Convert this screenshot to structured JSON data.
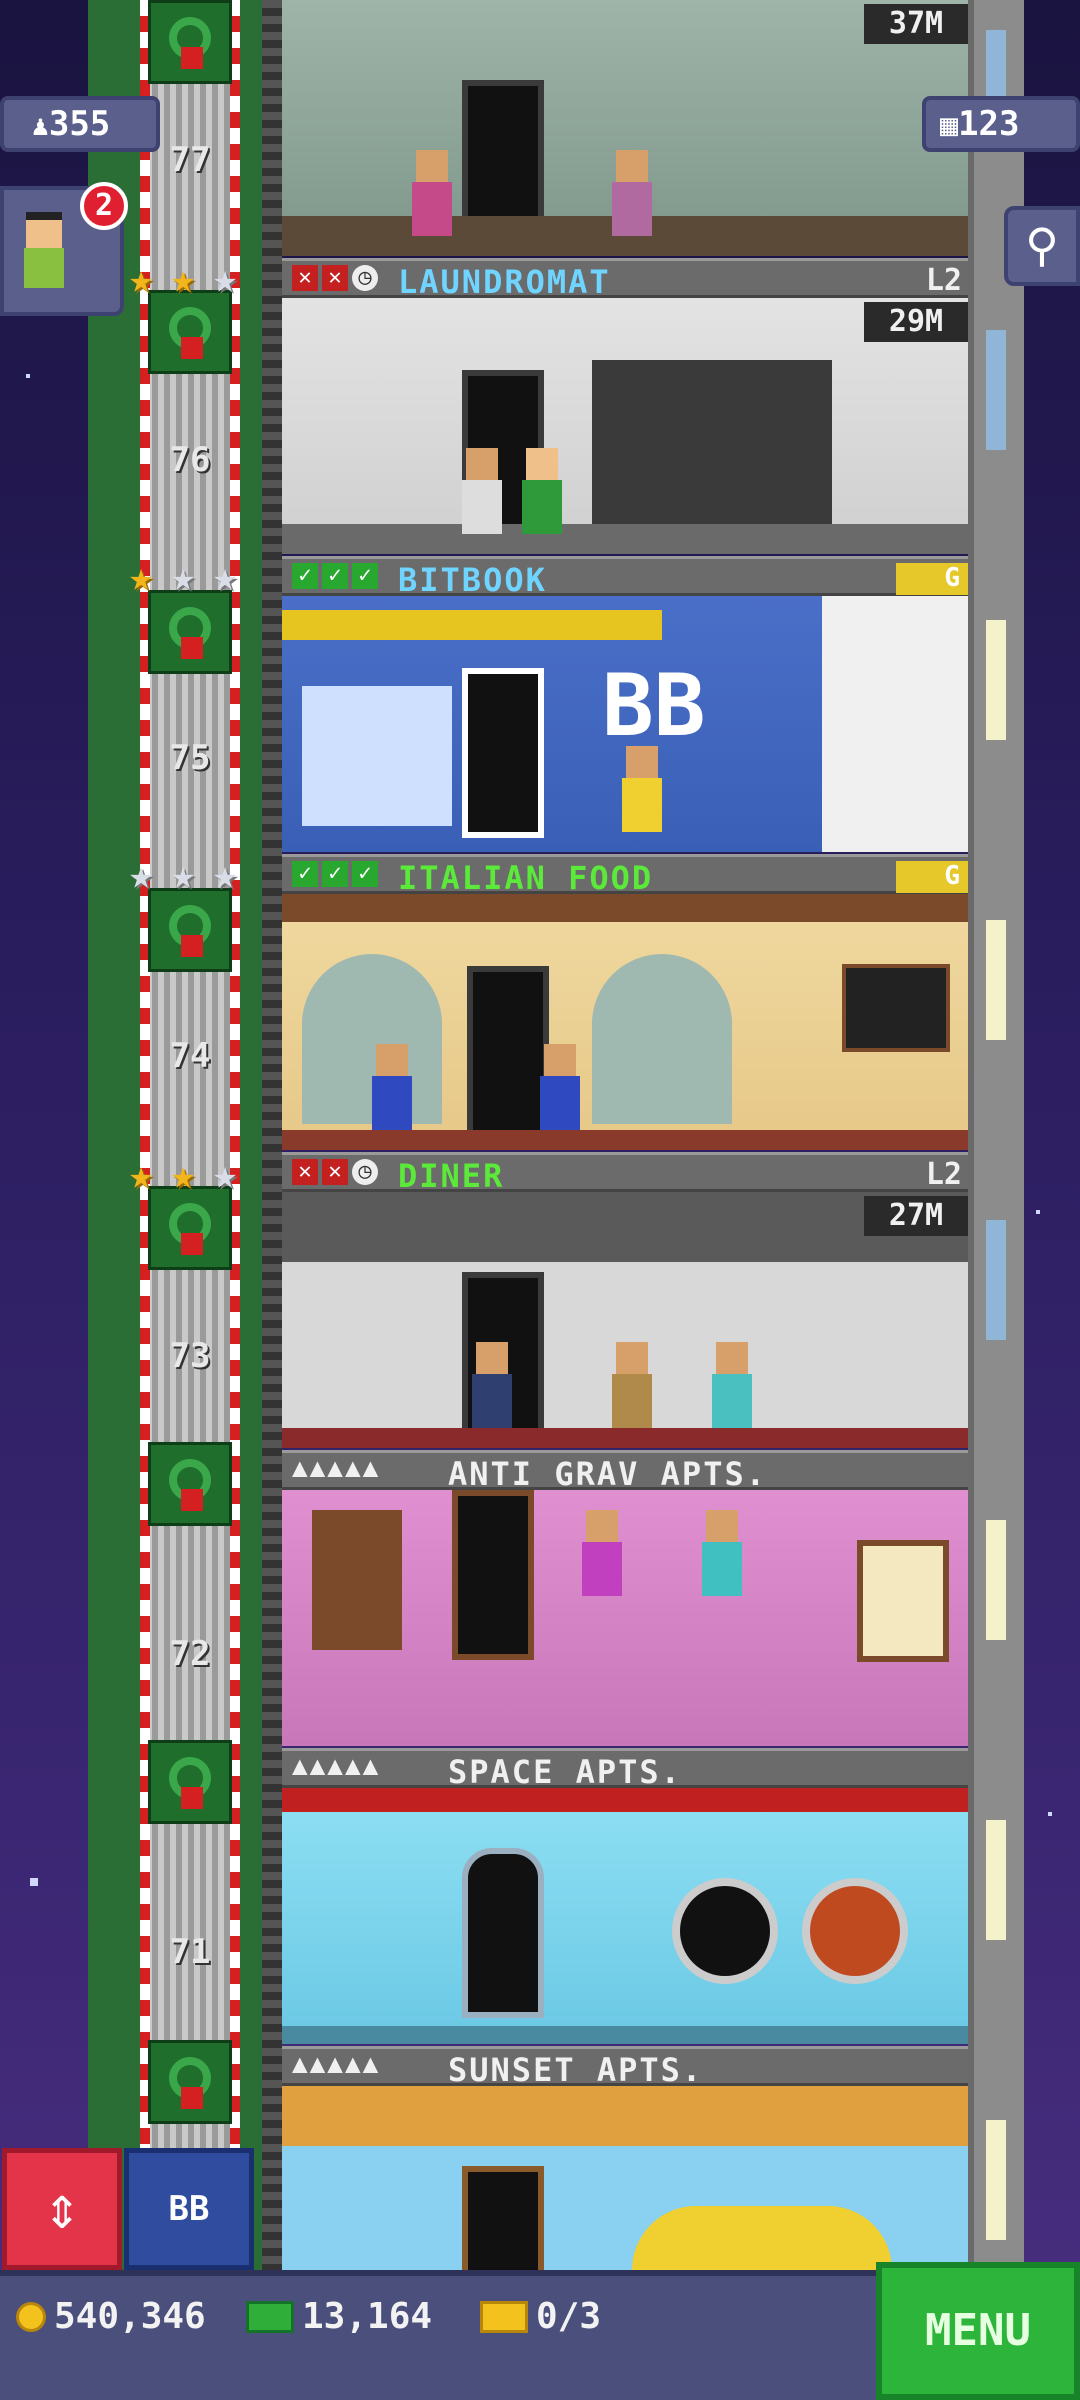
{
  "hud": {
    "population": "355",
    "floors": "123",
    "notification_count": "2"
  },
  "top_floor": {
    "money": "37M"
  },
  "floors": [
    {
      "name": "LAUNDROMAT",
      "level": "L2",
      "money": "29M",
      "number": "76"
    },
    {
      "name": "BITBOOK",
      "badge": "G",
      "number": "75",
      "sign": "BB"
    },
    {
      "name": "ITALIAN FOOD",
      "badge": "G",
      "number": "74"
    },
    {
      "name": "DINER",
      "level": "L2",
      "money": "27M",
      "number": "73"
    },
    {
      "name": "ANTI GRAV APTS.",
      "number": "72"
    },
    {
      "name": "SPACE APTS.",
      "number": "71"
    },
    {
      "name": "SUNSET APTS."
    }
  ],
  "shaft": {
    "top_number": "77"
  },
  "bottom": {
    "coins": "540,346",
    "bux": "13,164",
    "tickets": "0/3",
    "menu_label": "MENU",
    "bb_label": "BB"
  }
}
